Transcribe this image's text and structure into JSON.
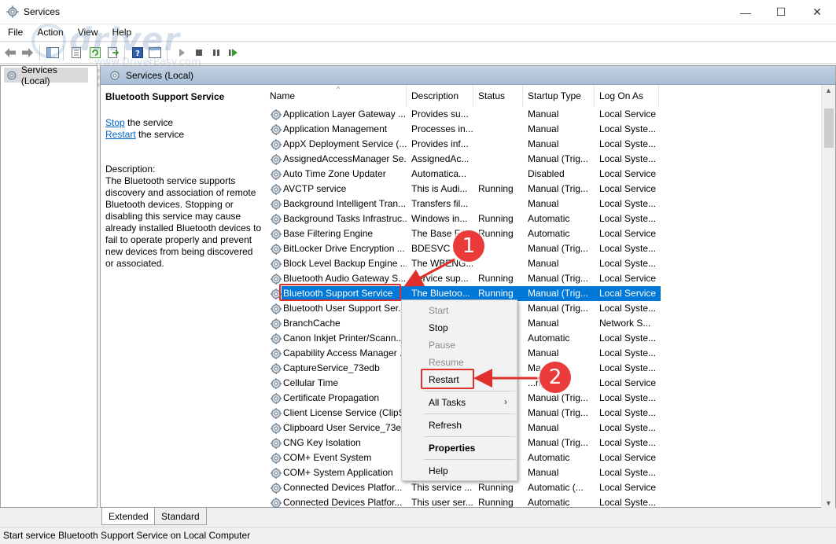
{
  "window": {
    "title": "Services",
    "minimize_glyph": "—",
    "maximize_glyph": "☐",
    "close_glyph": "✕"
  },
  "menu": [
    "File",
    "Action",
    "View",
    "Help"
  ],
  "watermark": {
    "text": "driver easy",
    "url": "www.DriverEasy.com"
  },
  "tree": {
    "root_label": "Services (Local)"
  },
  "pane": {
    "header": "Services (Local)",
    "selected_service": "Bluetooth Support Service",
    "stop_link": "Stop",
    "stop_suffix": " the service",
    "restart_link": "Restart",
    "restart_suffix": " the service",
    "description_label": "Description:",
    "description_text": "The Bluetooth service supports discovery and association of remote Bluetooth devices.  Stopping or disabling this service may cause already installed Bluetooth devices to fail to operate properly and prevent new devices from being discovered or associated."
  },
  "columns": [
    "Name",
    "Description",
    "Status",
    "Startup Type",
    "Log On As"
  ],
  "rows": [
    {
      "name": "Application Layer Gateway ...",
      "desc": "Provides su...",
      "status": "",
      "startup": "Manual",
      "logon": "Local Service"
    },
    {
      "name": "Application Management",
      "desc": "Processes in...",
      "status": "",
      "startup": "Manual",
      "logon": "Local Syste..."
    },
    {
      "name": "AppX Deployment Service (...",
      "desc": "Provides inf...",
      "status": "",
      "startup": "Manual",
      "logon": "Local Syste..."
    },
    {
      "name": "AssignedAccessManager Se...",
      "desc": "AssignedAc...",
      "status": "",
      "startup": "Manual (Trig...",
      "logon": "Local Syste..."
    },
    {
      "name": "Auto Time Zone Updater",
      "desc": "Automatica...",
      "status": "",
      "startup": "Disabled",
      "logon": "Local Service"
    },
    {
      "name": "AVCTP service",
      "desc": "This is Audi...",
      "status": "Running",
      "startup": "Manual (Trig...",
      "logon": "Local Service"
    },
    {
      "name": "Background Intelligent Tran...",
      "desc": "Transfers fil...",
      "status": "",
      "startup": "Manual",
      "logon": "Local Syste..."
    },
    {
      "name": "Background Tasks Infrastruc...",
      "desc": "Windows in...",
      "status": "Running",
      "startup": "Automatic",
      "logon": "Local Syste..."
    },
    {
      "name": "Base Filtering Engine",
      "desc": "The Base Fil...",
      "status": "Running",
      "startup": "Automatic",
      "logon": "Local Service"
    },
    {
      "name": "BitLocker Drive Encryption ...",
      "desc": "BDESVC h...",
      "status": "",
      "startup": "Manual (Trig...",
      "logon": "Local Syste..."
    },
    {
      "name": "Block Level Backup Engine ...",
      "desc": "The WBENG...",
      "status": "",
      "startup": "Manual",
      "logon": "Local Syste..."
    },
    {
      "name": "Bluetooth Audio Gateway S...",
      "desc": "Service sup...",
      "status": "Running",
      "startup": "Manual (Trig...",
      "logon": "Local Service"
    },
    {
      "name": "Bluetooth Support Service",
      "desc": "The Bluetoo...",
      "status": "Running",
      "startup": "Manual (Trig...",
      "logon": "Local Service"
    },
    {
      "name": "Bluetooth User Support Ser...",
      "desc": "",
      "status": "",
      "startup": "Manual (Trig...",
      "logon": "Local Syste..."
    },
    {
      "name": "BranchCache",
      "desc": "",
      "status": "",
      "startup": "Manual",
      "logon": "Network S..."
    },
    {
      "name": "Canon Inkjet Printer/Scann...",
      "desc": "",
      "status": "",
      "startup": "Automatic",
      "logon": "Local Syste..."
    },
    {
      "name": "Capability Access Manager ...",
      "desc": "",
      "status": "",
      "startup": "Manual",
      "logon": "Local Syste..."
    },
    {
      "name": "CaptureService_73edb",
      "desc": "",
      "status": "",
      "startup": "Ma...",
      "logon": "Local Syste..."
    },
    {
      "name": "Cellular Time",
      "desc": "",
      "status": "",
      "startup": "...rig...",
      "logon": "Local Service"
    },
    {
      "name": "Certificate Propagation",
      "desc": "",
      "status": "",
      "startup": "Manual (Trig...",
      "logon": "Local Syste..."
    },
    {
      "name": "Client License Service (ClipS...",
      "desc": "",
      "status": "",
      "startup": "Manual (Trig...",
      "logon": "Local Syste..."
    },
    {
      "name": "Clipboard User Service_73ed...",
      "desc": "",
      "status": "",
      "startup": "Manual",
      "logon": "Local Syste..."
    },
    {
      "name": "CNG Key Isolation",
      "desc": "",
      "status": "",
      "startup": "Manual (Trig...",
      "logon": "Local Syste..."
    },
    {
      "name": "COM+ Event System",
      "desc": "",
      "status": "",
      "startup": "Automatic",
      "logon": "Local Service"
    },
    {
      "name": "COM+ System Application",
      "desc": "",
      "status": "",
      "startup": "Manual",
      "logon": "Local Syste..."
    },
    {
      "name": "Connected Devices Platfor...",
      "desc": "This service ...",
      "status": "Running",
      "startup": "Automatic (...",
      "logon": "Local Service"
    },
    {
      "name": "Connected Devices Platfor...",
      "desc": "This user ser...",
      "status": "Running",
      "startup": "Automatic",
      "logon": "Local Syste..."
    }
  ],
  "context_menu": {
    "start": "Start",
    "stop": "Stop",
    "pause": "Pause",
    "resume": "Resume",
    "restart": "Restart",
    "all_tasks": "All Tasks",
    "refresh": "Refresh",
    "properties": "Properties",
    "help": "Help"
  },
  "tabs": [
    "Extended",
    "Standard"
  ],
  "status_bar": "Start service Bluetooth Support Service on Local Computer",
  "annotations": {
    "step1": "1",
    "step2": "2"
  },
  "colors": {
    "selection": "#0078d7",
    "annotation": "#e0302e",
    "link": "#0066cc",
    "header_band": "#b8c9dd"
  }
}
